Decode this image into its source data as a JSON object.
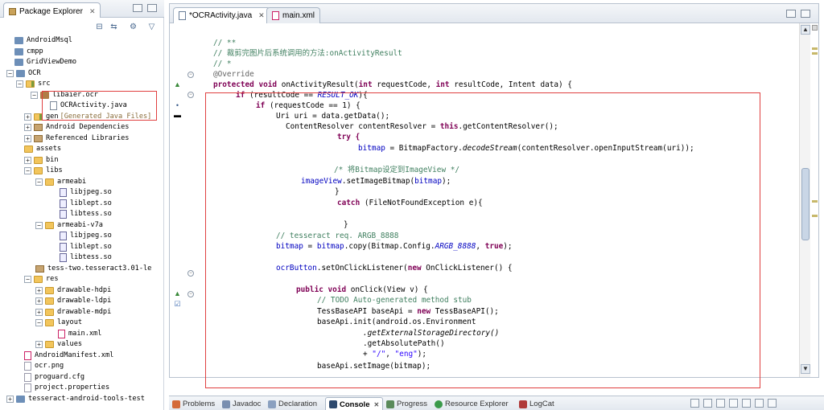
{
  "package_explorer": {
    "title": "Package Explorer",
    "tree": [
      {
        "label": "AndroidMsql",
        "icon": "project-icon"
      },
      {
        "label": "cmpp",
        "icon": "project-icon"
      },
      {
        "label": "GridViewDemo",
        "icon": "project-icon"
      },
      {
        "label": "OCR",
        "icon": "project-icon",
        "expanded": true
      },
      {
        "label": "src",
        "icon": "source-folder-icon",
        "expanded": true
      },
      {
        "label": "libaier.ocr",
        "icon": "package-icon",
        "expanded": true
      },
      {
        "label": "OCRActivity.java",
        "icon": "java-file-icon"
      },
      {
        "label": "gen",
        "note": "[Generated Java Files]",
        "icon": "source-folder-icon"
      },
      {
        "label": "Android Dependencies",
        "icon": "library-icon"
      },
      {
        "label": "Referenced Libraries",
        "icon": "library-icon"
      },
      {
        "label": "assets",
        "icon": "folder-icon"
      },
      {
        "label": "bin",
        "icon": "folder-icon"
      },
      {
        "label": "libs",
        "icon": "folder-icon",
        "expanded": true
      },
      {
        "label": "armeabi",
        "icon": "folder-icon",
        "expanded": true
      },
      {
        "label": "libjpeg.so",
        "icon": "so-file-icon"
      },
      {
        "label": "liblept.so",
        "icon": "so-file-icon"
      },
      {
        "label": "libtess.so",
        "icon": "so-file-icon"
      },
      {
        "label": "armeabi-v7a",
        "icon": "folder-icon",
        "expanded": true
      },
      {
        "label": "libjpeg.so",
        "icon": "so-file-icon"
      },
      {
        "label": "liblept.so",
        "icon": "so-file-icon"
      },
      {
        "label": "libtess.so",
        "icon": "so-file-icon"
      },
      {
        "label": "tess-two.tesseract3.01-le",
        "icon": "jar-file-icon"
      },
      {
        "label": "res",
        "icon": "folder-icon",
        "expanded": true
      },
      {
        "label": "drawable-hdpi",
        "icon": "folder-icon"
      },
      {
        "label": "drawable-ldpi",
        "icon": "folder-icon"
      },
      {
        "label": "drawable-mdpi",
        "icon": "folder-icon"
      },
      {
        "label": "layout",
        "icon": "folder-icon",
        "expanded": true
      },
      {
        "label": "main.xml",
        "icon": "xml-file-icon"
      },
      {
        "label": "values",
        "icon": "folder-icon"
      },
      {
        "label": "AndroidManifest.xml",
        "icon": "xml-file-icon"
      },
      {
        "label": "ocr.png",
        "icon": "image-file-icon"
      },
      {
        "label": "proguard.cfg",
        "icon": "file-icon"
      },
      {
        "label": "project.properties",
        "icon": "file-icon"
      },
      {
        "label": "tesseract-android-tools-test",
        "icon": "project-icon"
      }
    ]
  },
  "editor": {
    "tabs": [
      {
        "label": "*OCRActivity.java",
        "active": true
      },
      {
        "label": "main.xml",
        "active": false
      }
    ],
    "lines": [
      "// **",
      "// 裁剪完图片后系统调用的方法:onActivityResult",
      "// *",
      "@Override",
      "protected void onActivityResult(int requestCode, int resultCode, Intent data) {",
      "if (resultCode == RESULT_OK){",
      "if (requestCode == 1) {",
      "Uri uri = data.getData();",
      "ContentResolver contentResolver = this.getContentResolver();",
      "try {",
      "bitmap = BitmapFactory.decodeStream(contentResolver.openInputStream(uri));",
      "/* 将Bitmap设定到ImageView */",
      "imageView.setImageBitmap(bitmap);",
      "}",
      "catch (FileNotFoundException e){",
      "}",
      "// tesseract req. ARGB_8888",
      "bitmap = bitmap.copy(Bitmap.Config.ARGB_8888, true);",
      "ocrButton.setOnClickListener(new OnClickListener() {",
      "public void onClick(View v) {",
      "// TODO Auto-generated method stub",
      "TessBaseAPI baseApi = new TessBaseAPI();",
      "baseApi.init(android.os.Environment",
      ".getExternalStorageDirectory()",
      ".getAbsolutePath()",
      "+ \"/\", \"eng\");",
      "baseApi.setImage(bitmap);"
    ]
  },
  "bottom_tabs": [
    {
      "label": "Problems",
      "active": false
    },
    {
      "label": "Javadoc",
      "active": false
    },
    {
      "label": "Declaration",
      "active": false
    },
    {
      "label": "Console",
      "active": true
    },
    {
      "label": "Progress",
      "active": false
    },
    {
      "label": "Resource Explorer",
      "active": false
    },
    {
      "label": "LogCat",
      "active": false
    }
  ],
  "colors": {
    "comment": "#3f7f5f",
    "keyword": "#7f0055",
    "string": "#2a00ff",
    "field": "#0000c0",
    "highlight_box": "#e04040"
  }
}
